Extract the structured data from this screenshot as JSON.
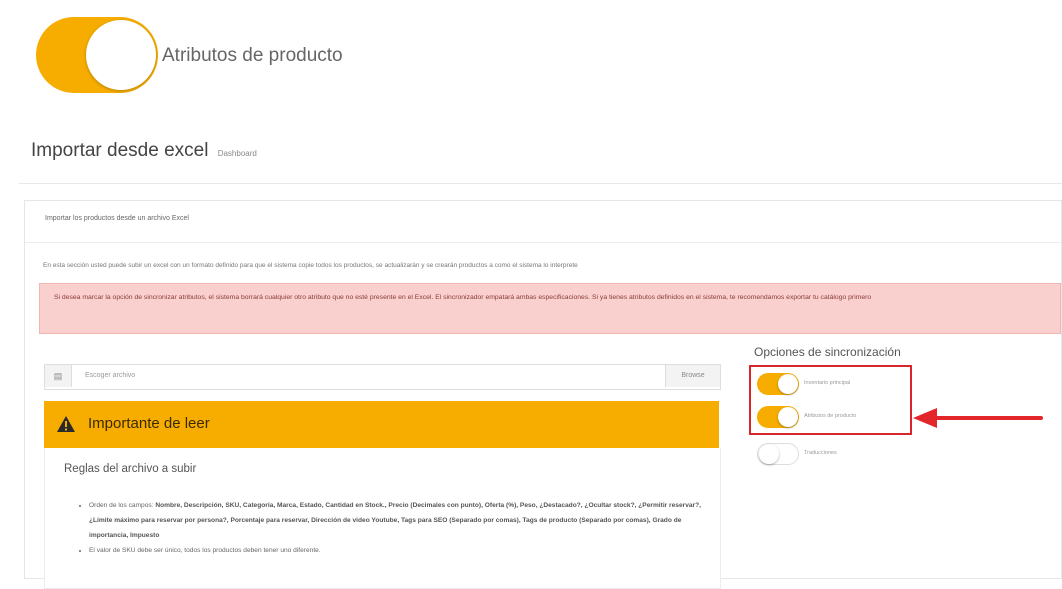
{
  "hero": {
    "label": "Atributos de producto"
  },
  "header": {
    "title": "Importar desde excel",
    "subtitle": "Dashboard"
  },
  "card": {
    "header": "Importar los productos desde un archivo Excel",
    "intro": "En esta sección usted puede subir un excel con un formato definido para que el sistema copie todos los productos, se actualizarán y se crearán productos a como el sistema lo interprete",
    "alert": "Si desea marcar la opción de sincronizar atributos, el sistema borrará cualquier otro atributo que no esté presente en el Excel. El sincronizador empatará ambas especificaciones. Si ya tienes atributos definidos en el sistema, te recomendamos exportar tu catálogo primero"
  },
  "file_input": {
    "icon": "file-icon",
    "placeholder": "Escoger archivo",
    "browse_label": "Browse"
  },
  "warning": {
    "title": "Importante de leer",
    "rules_title": "Reglas del archivo a subir",
    "rule1_intro": "Orden de los campos:",
    "rule1_fields": "Nombre, Descripción, SKU, Categoría, Marca, Estado, Cantidad en Stock., Precio (Decimales con punto), Oferta (%), Peso, ¿Destacado?, ¿Ocultar stock?, ¿Permitir reservar?, ¿Límite máximo para reservar por persona?, Porcentaje para reservar, Dirección de video Youtube, Tags para SEO (Separado por comas), Tags de producto (Separado por comas), Grado de importancia, Impuesto",
    "rule2": "El valor de SKU debe ser único, todos los productos deben tener uno diferente."
  },
  "sync": {
    "title": "Opciones de sincronización",
    "options": [
      {
        "label": "Inventario principal",
        "checked": true
      },
      {
        "label": "Atributos de producto",
        "checked": true
      },
      {
        "label": "Traducciones",
        "checked": false
      }
    ]
  },
  "colors": {
    "accent": "#f6ad00",
    "alert_bg": "#f9d0ce",
    "highlight": "#d9262c"
  }
}
